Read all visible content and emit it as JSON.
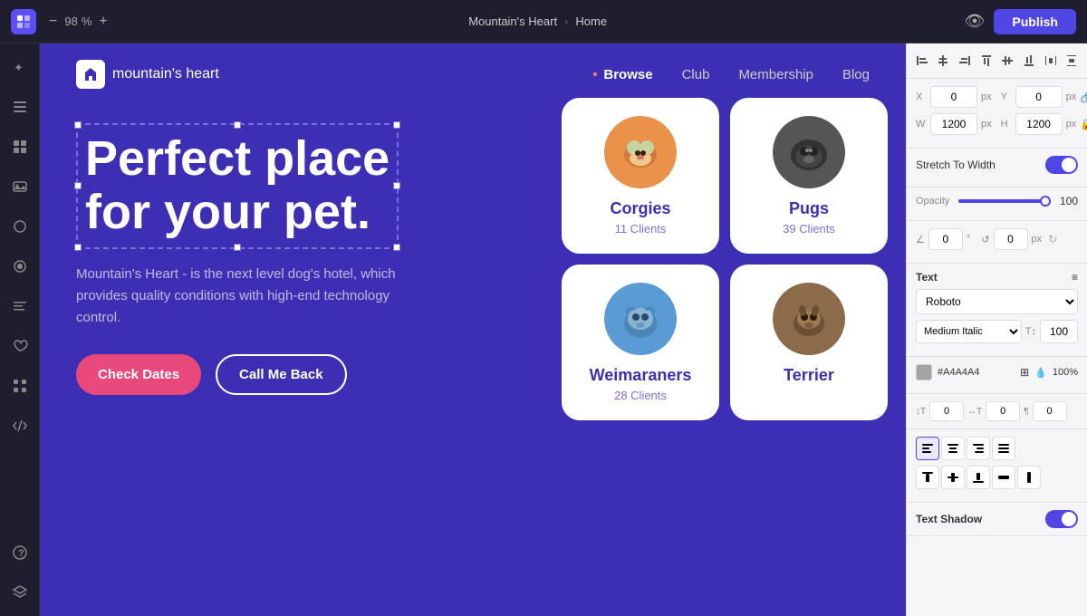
{
  "topbar": {
    "zoom_minus": "−",
    "zoom_value": "98",
    "zoom_percent": "%",
    "zoom_plus": "+",
    "title": "Mountain's Heart",
    "breadcrumb_sep": "›",
    "page": "Home",
    "eye_icon": "👁",
    "publish_label": "Publish"
  },
  "sidebar": {
    "items": [
      {
        "icon": "✦",
        "name": "ai-icon"
      },
      {
        "icon": "☰",
        "name": "pages-icon"
      },
      {
        "icon": "⊞",
        "name": "grid-icon"
      },
      {
        "icon": "🖼",
        "name": "media-icon"
      },
      {
        "icon": "○",
        "name": "shapes-icon"
      },
      {
        "icon": "◎",
        "name": "effects-icon"
      },
      {
        "icon": "≡",
        "name": "text-icon"
      },
      {
        "icon": "♡",
        "name": "favorites-icon"
      },
      {
        "icon": "⊡",
        "name": "apps-icon"
      },
      {
        "icon": "</>",
        "name": "code-icon"
      }
    ],
    "bottom_items": [
      {
        "icon": "?",
        "name": "help-icon"
      },
      {
        "icon": "◈",
        "name": "layers-icon"
      }
    ]
  },
  "preview": {
    "logo_text": "mountain's heart",
    "nav_items": [
      {
        "label": "Browse",
        "active": true
      },
      {
        "label": "Club",
        "active": false
      },
      {
        "label": "Membership",
        "active": false
      },
      {
        "label": "Blog",
        "active": false
      }
    ],
    "hero_title_line1": "Perfect place",
    "hero_title_line2": "for your pet.",
    "hero_subtitle": "Mountain's Heart - is the next level dog's hotel, which provides quality conditions with high-end technology control.",
    "btn_primary": "Check Dates",
    "btn_secondary": "Call Me Back",
    "pets": [
      {
        "name": "Corgies",
        "clients": "11 Clients",
        "emoji": "🐕",
        "color": "#e8924a",
        "type": "corgi"
      },
      {
        "name": "Pugs",
        "clients": "39 Clients",
        "emoji": "🐾",
        "color": "#555",
        "type": "pug"
      },
      {
        "name": "Weimaraners",
        "clients": "28 Clients",
        "emoji": "🐕",
        "color": "#5b9bd5",
        "type": "weimar"
      },
      {
        "name": "Terrier",
        "clients": "",
        "emoji": "🐶",
        "color": "#8b6b4a",
        "type": "terrier"
      }
    ]
  },
  "right_panel": {
    "x_label": "X",
    "x_value": "0",
    "y_label": "Y",
    "y_value": "0",
    "w_label": "W",
    "w_value": "1200",
    "h_label": "H",
    "h_value": "1200",
    "px_unit": "px",
    "stretch_label": "Stretch To Width",
    "opacity_label": "Opacity",
    "opacity_value": "100",
    "angle_value": "0",
    "angle_unit": "°",
    "rotate_value": "0",
    "text_section": "Text",
    "font_family": "Roboto",
    "font_style": "Medium Italic",
    "font_size": "100",
    "color_hex": "#A4A4A4",
    "color_opacity": "100%",
    "color_icons": "⊞",
    "spacing_vals": [
      "0",
      "0",
      "0"
    ],
    "text_shadow_label": "Text Shadow",
    "align_left": "≡",
    "align_center": "≡",
    "align_right": "≡",
    "align_justify": "≡"
  }
}
